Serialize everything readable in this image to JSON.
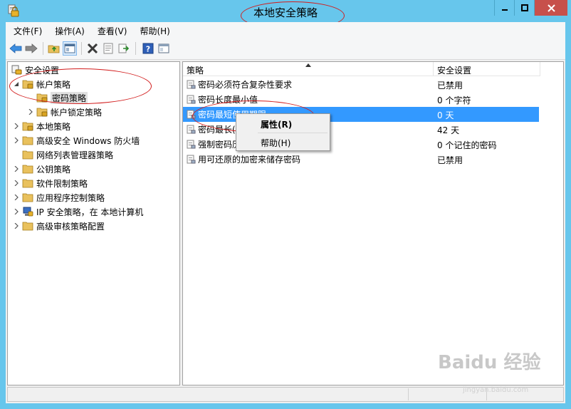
{
  "window": {
    "title": "本地安全策略",
    "minimize_icon": "minimize-icon",
    "maximize_icon": "maximize-icon",
    "close_icon": "close-icon"
  },
  "menu": [
    "文件(F)",
    "操作(A)",
    "查看(V)",
    "帮助(H)"
  ],
  "toolbar": {
    "buttons": [
      "back-arrow-icon",
      "forward-arrow-icon",
      "up-folder-icon",
      "show-hide-tree-icon",
      "delete-icon",
      "properties-icon",
      "export-list-icon",
      "help-icon",
      "console-icon"
    ]
  },
  "tree": {
    "root": "安全设置",
    "items": [
      {
        "label": "帐户策略",
        "expanded": true
      },
      {
        "label": "密码策略",
        "selected": true
      },
      {
        "label": "帐户锁定策略"
      },
      {
        "label": "本地策略"
      },
      {
        "label": "高级安全 Windows 防火墙"
      },
      {
        "label": "网络列表管理器策略"
      },
      {
        "label": "公钥策略"
      },
      {
        "label": "软件限制策略"
      },
      {
        "label": "应用程序控制策略"
      },
      {
        "label": "IP 安全策略，在 本地计算机"
      },
      {
        "label": "高级审核策略配置"
      }
    ]
  },
  "list": {
    "columns": [
      "策略",
      "安全设置"
    ],
    "sort_indicator": "sort-ascending-icon",
    "rows": [
      {
        "policy": "密码必须符合复杂性要求",
        "setting": "已禁用"
      },
      {
        "policy": "密码长度最小值",
        "setting": "0 个字符"
      },
      {
        "policy": "密码最短使用期限",
        "setting": "0 天",
        "selected": true
      },
      {
        "policy": "密码最长使用期限",
        "policy_visible": "密码最长(",
        "setting": "42 天"
      },
      {
        "policy": "强制密码历史",
        "policy_visible": "强制密码历",
        "setting": "0 个记住的密码"
      },
      {
        "policy": "用可还原的加密来储存密码",
        "setting": "已禁用"
      }
    ]
  },
  "context_menu": {
    "items": [
      "属性(R)",
      "帮助(H)"
    ]
  },
  "watermark": {
    "text": "Baidu 经验",
    "sub": "jingyan.baidu.com"
  },
  "colors": {
    "title_bar": "#67c6ec",
    "selection": "#3399ff",
    "annotation_red": "#d21d1d",
    "close_button": "#c7504b"
  }
}
